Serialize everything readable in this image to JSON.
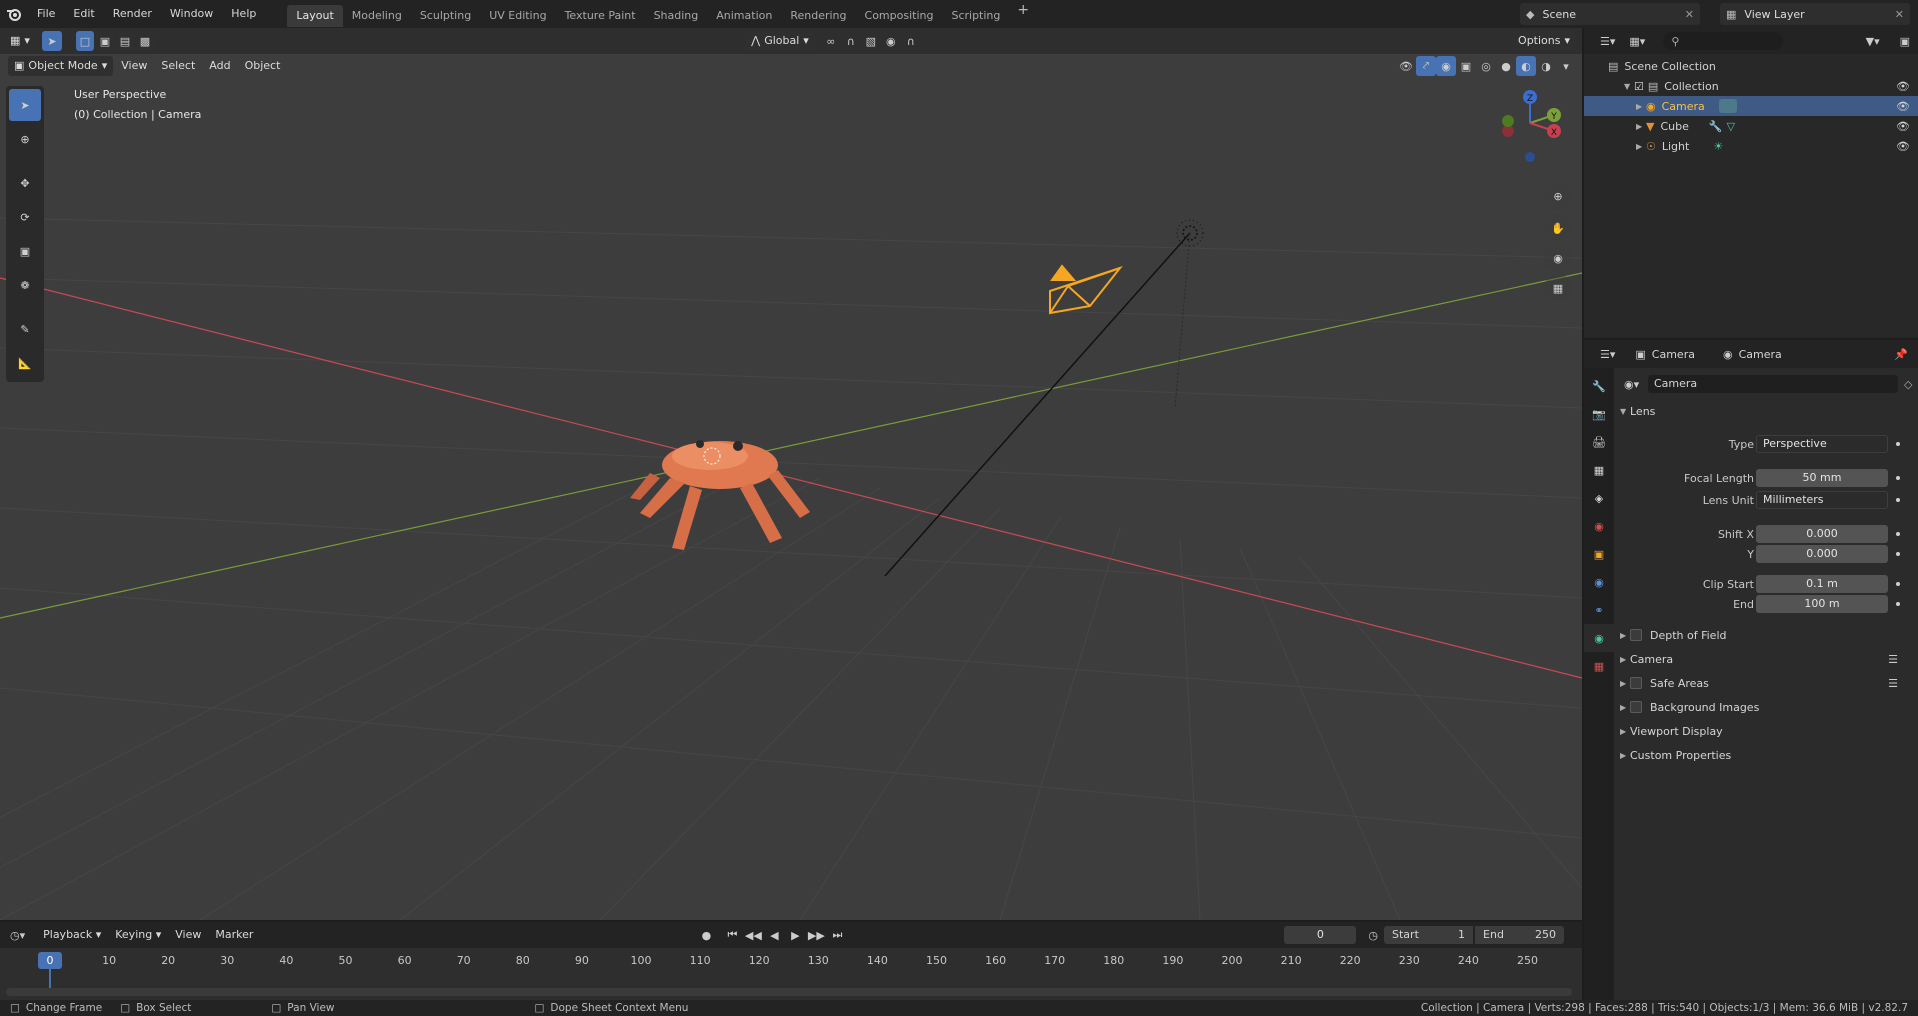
{
  "topbar": {
    "menu": [
      "File",
      "Edit",
      "Render",
      "Window",
      "Help"
    ],
    "workspaces": [
      "Layout",
      "Modeling",
      "Sculpting",
      "UV Editing",
      "Texture Paint",
      "Shading",
      "Animation",
      "Rendering",
      "Compositing",
      "Scripting"
    ],
    "active_workspace": "Layout",
    "scene": "Scene",
    "view_layer": "View Layer"
  },
  "viewport": {
    "mode": "Object Mode",
    "menus": [
      "View",
      "Select",
      "Add",
      "Object"
    ],
    "transform_orientation": "Global",
    "options": "Options",
    "overlay_line1": "User Perspective",
    "overlay_line2": "(0) Collection | Camera"
  },
  "gizmo": {
    "z": "Z",
    "y": "Y",
    "x": "X"
  },
  "outliner": {
    "root": "Scene Collection",
    "collection": "Collection",
    "items": [
      "Camera",
      "Cube",
      "Light"
    ]
  },
  "properties": {
    "header_object": "Camera",
    "header_data": "Camera",
    "datablock": "Camera",
    "lens_panel": "Lens",
    "type_label": "Type",
    "type_value": "Perspective",
    "focal_label": "Focal Length",
    "focal_value": "50 mm",
    "lens_unit_label": "Lens Unit",
    "lens_unit_value": "Millimeters",
    "shiftx_label": "Shift X",
    "shiftx_value": "0.000",
    "shifty_label": "Y",
    "shifty_value": "0.000",
    "clip_start_label": "Clip Start",
    "clip_start_value": "0.1 m",
    "clip_end_label": "End",
    "clip_end_value": "100 m",
    "panels": [
      "Depth of Field",
      "Camera",
      "Safe Areas",
      "Background Images",
      "Viewport Display",
      "Custom Properties"
    ]
  },
  "timeline": {
    "menus": [
      "Playback",
      "Keying",
      "View",
      "Marker"
    ],
    "current_frame": "0",
    "start_label": "Start",
    "start_value": "1",
    "end_label": "End",
    "end_value": "250",
    "ticks": [
      "0",
      "10",
      "20",
      "30",
      "40",
      "50",
      "60",
      "70",
      "80",
      "90",
      "100",
      "110",
      "120",
      "130",
      "140",
      "150",
      "160",
      "170",
      "180",
      "190",
      "200",
      "210",
      "220",
      "230",
      "240",
      "250"
    ]
  },
  "status": {
    "left1": "Change Frame",
    "left2": "Box Select",
    "left3": "Pan View",
    "left4": "Dope Sheet Context Menu",
    "right": "Collection | Camera | Verts:298 | Faces:288 | Tris:540 | Objects:1/3 | Mem: 36.6 MiB | v2.82.7"
  },
  "colors": {
    "accent": "#4772b3",
    "selected_row": "#3f5b85",
    "object_orange": "#f5a623",
    "x_axis": "#c84a55",
    "y_axis": "#7a9c3a"
  }
}
